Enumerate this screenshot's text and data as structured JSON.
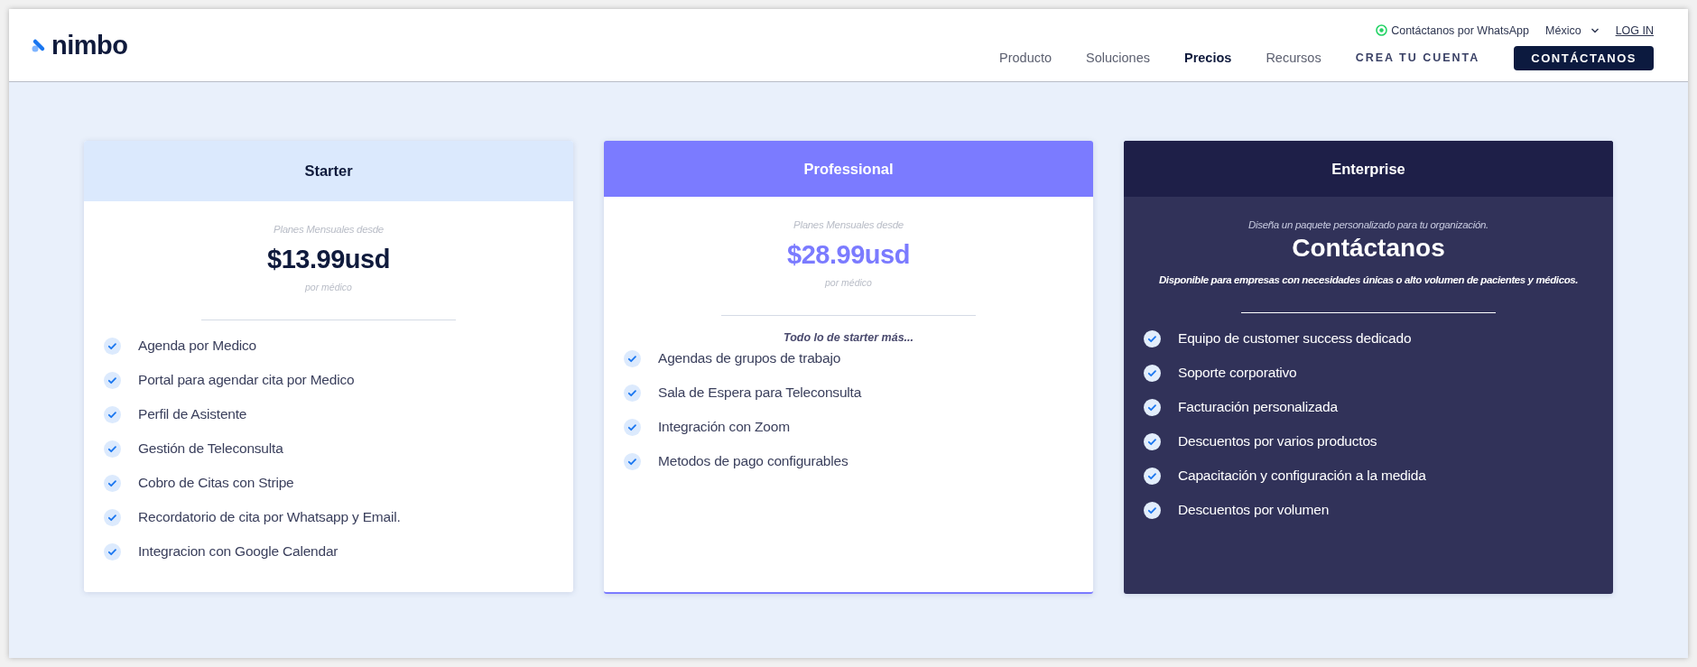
{
  "header": {
    "logo": "nimbo",
    "whatsapp_link": "Contáctanos por WhatsApp",
    "country": "México",
    "login": "LOG IN",
    "nav": [
      {
        "label": "Producto",
        "selected": false
      },
      {
        "label": "Soluciones",
        "selected": false
      },
      {
        "label": "Precios",
        "selected": true
      },
      {
        "label": "Recursos",
        "selected": false
      }
    ],
    "signup": "CREA TU CUENTA",
    "contact_button": "CONTÁCTANOS"
  },
  "plans": [
    {
      "kind": "price",
      "color": "#dbe9fd",
      "name": "Starter",
      "caption": "Planes Mensuales desde",
      "price": "$13.99usd",
      "unit": "por médico",
      "features": [
        "Agenda por Medico",
        "Portal para agendar cita por Medico",
        "Perfil de Asistente",
        "Gestión de Teleconsulta",
        "Cobro de Citas con Stripe",
        "Recordatorio de cita por Whatsapp y Email.",
        "Integracion con Google Calendar"
      ]
    },
    {
      "kind": "price",
      "color": "#7b7bff",
      "name": "Professional",
      "caption": "Planes Mensuales desde",
      "price": "$28.99usd",
      "unit": "por médico",
      "lead": "Todo lo de starter más...",
      "features": [
        "Agendas de grupos de trabajo",
        "Sala de Espera para Teleconsulta",
        "Integración con Zoom",
        "Metodos de pago configurables"
      ]
    },
    {
      "kind": "contact",
      "color": "#1e1f48",
      "name": "Enterprise",
      "caption": "Diseña un paquete personalizado para tu organización.",
      "headline": "Contáctanos",
      "note": "Disponible para empresas con necesidades únicas o alto volumen de pacientes y médicos.",
      "features": [
        "Equipo de customer success dedicado",
        "Soporte corporativo",
        "Facturación personalizada",
        "Descuentos por varios productos",
        "Capacitación y configuración a la medida",
        "Descuentos por volumen"
      ]
    }
  ]
}
